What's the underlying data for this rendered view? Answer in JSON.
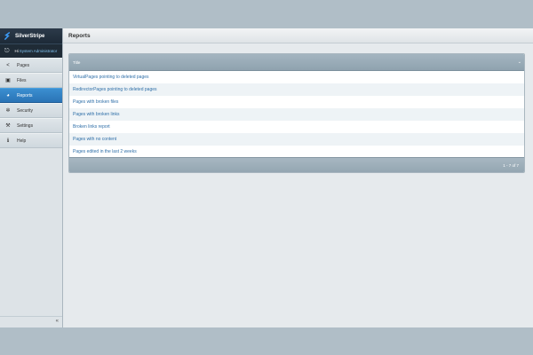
{
  "brand": {
    "name": "SilverStripe"
  },
  "user": {
    "greeting": "Hi",
    "name": "System Administrator"
  },
  "menu": [
    {
      "label": "Pages",
      "icon": "share-icon",
      "glyph": "<"
    },
    {
      "label": "Files",
      "icon": "image-icon",
      "glyph": "▣"
    },
    {
      "label": "Reports",
      "icon": "pie-chart-icon",
      "glyph": "◕",
      "active": true
    },
    {
      "label": "Security",
      "icon": "gear-icon",
      "glyph": "✲"
    },
    {
      "label": "Settings",
      "icon": "wrench-icon",
      "glyph": "⚒"
    },
    {
      "label": "Help",
      "icon": "info-icon",
      "glyph": "ℹ"
    }
  ],
  "header": {
    "title": "Reports"
  },
  "grid": {
    "column": "Title",
    "rows": [
      "VirtualPages pointing to deleted pages",
      "RedirectorPages pointing to deleted pages",
      "Pages with broken files",
      "Pages with broken links",
      "Broken links report",
      "Pages with no content",
      "Pages edited in the last 2 weeks"
    ],
    "pagination": "1 - 7 of 7"
  },
  "sidebar": {
    "collapse_glyph": "«"
  },
  "colors": {
    "accent": "#2a73b6",
    "link": "#2f6fa8",
    "brand_bg": "#1d2a37"
  }
}
